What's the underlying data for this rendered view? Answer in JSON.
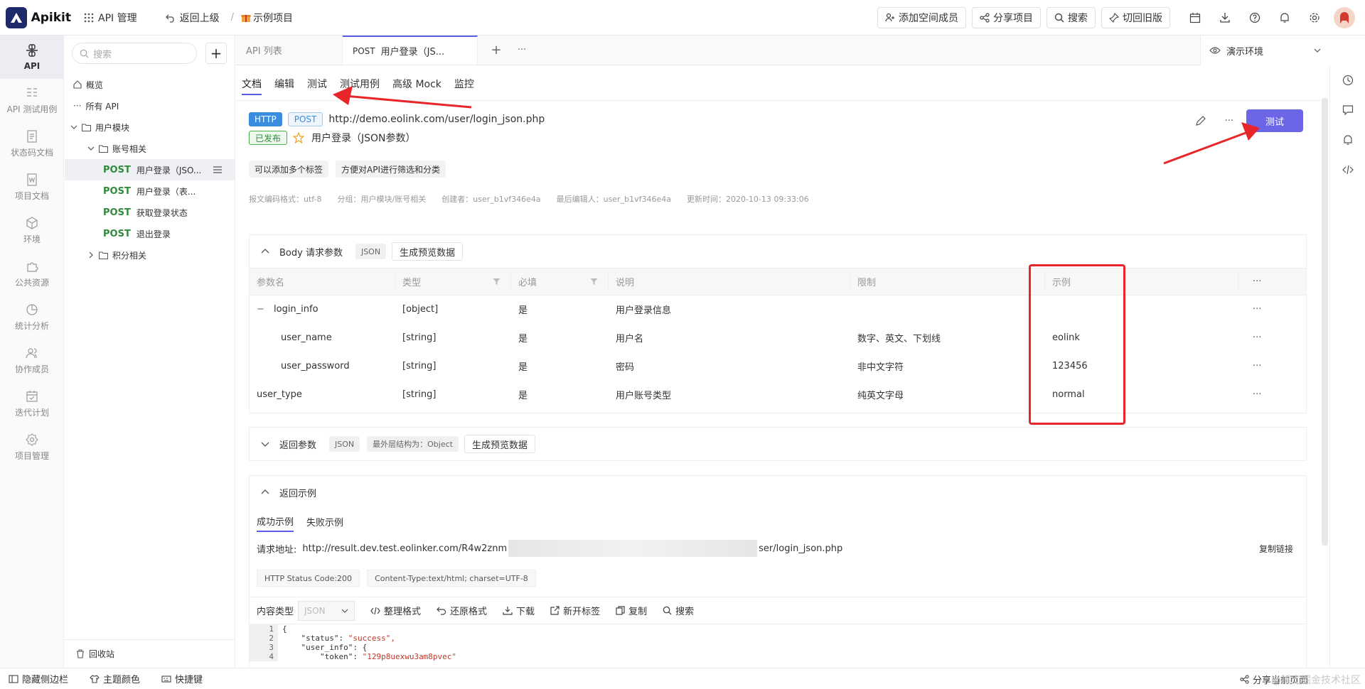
{
  "topbar": {
    "app_name": "Apikit",
    "api_manage": "API 管理",
    "back": "返回上级",
    "separator": "/",
    "project": "示例项目",
    "buttons": {
      "add_member": "添加空间成员",
      "share": "分享项目",
      "search": "搜索",
      "old_version": "切回旧版"
    }
  },
  "leftnav": {
    "items": [
      "API",
      "API 测试用例",
      "状态码文档",
      "项目文档",
      "环境",
      "公共资源",
      "统计分析",
      "协作成员",
      "迭代计划",
      "项目管理"
    ]
  },
  "tree": {
    "search_placeholder": "搜索",
    "add": "+",
    "overview": "概览",
    "all_api": "所有 API",
    "group_user": "用户模块",
    "group_account": "账号相关",
    "apis": [
      {
        "method": "POST",
        "name": "用户登录（JSO..."
      },
      {
        "method": "POST",
        "name": "用户登录（表..."
      },
      {
        "method": "POST",
        "name": "获取登录状态"
      },
      {
        "method": "POST",
        "name": "退出登录"
      }
    ],
    "group_points": "积分相关",
    "recycle": "回收站"
  },
  "tabs": {
    "api_list": "API 列表",
    "active_method": "POST",
    "active_name": "用户登录（JS...",
    "plus": "+",
    "more": "···",
    "env": "演示环境"
  },
  "subtabs": [
    "文档",
    "编辑",
    "测试",
    "测试用例",
    "高级 Mock",
    "监控"
  ],
  "api": {
    "protocol": "HTTP",
    "method": "POST",
    "url": "http://demo.eolink.com/user/login_json.php",
    "status": "已发布",
    "name": "用户登录（JSON参数）",
    "test_button": "测试",
    "tags": [
      "可以添加多个标签",
      "方便对API进行筛选和分类"
    ],
    "meta": [
      "报文编码格式：utf-8",
      "分组：用户模块/账号相关",
      "创建者：user_b1vf346e4a",
      "最后编辑人：user_b1vf346e4a",
      "更新时间：2020-10-13 09:33:06"
    ]
  },
  "body_params": {
    "title": "Body 请求参数",
    "format": "JSON",
    "gen_button": "生成预览数据",
    "columns": [
      "参数名",
      "类型",
      "必填",
      "说明",
      "限制",
      "示例"
    ],
    "rows": [
      {
        "name": "login_info",
        "type": "[object]",
        "required": "是",
        "desc": "用户登录信息",
        "limit": "",
        "example": "",
        "expand": "−"
      },
      {
        "name": "user_name",
        "type": "[string]",
        "required": "是",
        "desc": "用户名",
        "limit": "数字、英文、下划线",
        "example": "eolink"
      },
      {
        "name": "user_password",
        "type": "[string]",
        "required": "是",
        "desc": "密码",
        "limit": "非中文字符",
        "example": "123456"
      },
      {
        "name": "user_type",
        "type": "[string]",
        "required": "是",
        "desc": "用户账号类型",
        "limit": "纯英文字母",
        "example": "normal"
      }
    ]
  },
  "return_params": {
    "title": "返回参数",
    "format": "JSON",
    "outer": "最外层结构为：Object",
    "gen_button": "生成预览数据"
  },
  "return_example": {
    "title": "返回示例",
    "tabs": [
      "成功示例",
      "失败示例"
    ],
    "req_label": "请求地址:",
    "req_url_start": "http://result.dev.test.eolinker.com/R4w2znm",
    "req_url_end": "ser/login_json.php",
    "copy_link": "复制链接",
    "status_code": "HTTP Status Code:200",
    "content_type": "Content-Type:text/html; charset=UTF-8",
    "content_type_label": "内容类型",
    "content_type_value": "JSON",
    "tools": [
      "整理格式",
      "还原格式",
      "下载",
      "新开标签",
      "复制",
      "搜索"
    ],
    "code": [
      {
        "n": "1",
        "text": "{"
      },
      {
        "n": "2",
        "key": "    \"status\": ",
        "val": "\"success\","
      },
      {
        "n": "3",
        "key": "    \"user_info\": {",
        "val": ""
      },
      {
        "n": "4",
        "key": "        \"token\": ",
        "val": "\"129p8uexwu3am8pvec\""
      }
    ]
  },
  "bottombar": {
    "hide_sidebar": "隐藏侧边栏",
    "theme": "主题颜色",
    "shortcut": "快捷键",
    "share_page": "分享当前页面",
    "watermark": "@稀土掘金技术社区"
  },
  "colors": {
    "accent": "#5a5ce6",
    "post": "#2e8b3a",
    "highlight": "#e8262a"
  }
}
